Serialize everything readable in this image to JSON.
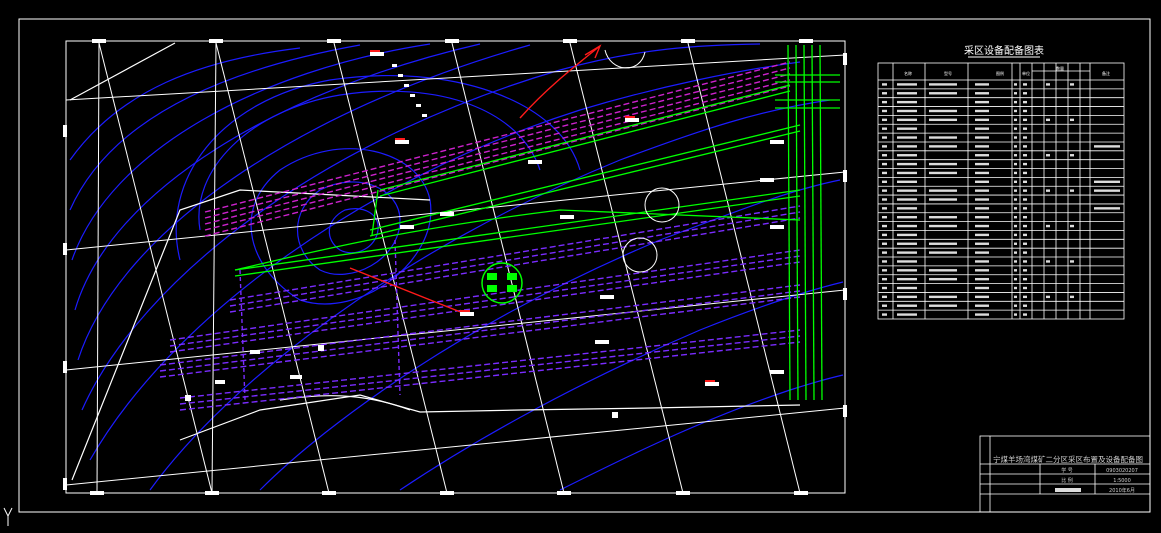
{
  "drawing": {
    "table_title": "采区设备配备图表",
    "title_block": {
      "main_title": "宁煤羊场湾煤矿二分区采区布置及设备配备图",
      "row1_label": "学  号",
      "row1_value": "0903020207",
      "row2_label": "比  例",
      "row2_value": "1:5000",
      "row3_value": "2010年6月"
    },
    "table_header": {
      "col_name": "名称",
      "col_model": "型号",
      "col_fig": "图例",
      "col_unit": "单位",
      "col_qty": "数量",
      "col_note": "备注"
    },
    "colors": {
      "background": "#000000",
      "frame": "#ffffff",
      "contour": "#1c1cff",
      "roadway": "#00ff00",
      "workface": "#cc22cc",
      "grid_line": "#ffffff",
      "annotation": "#ff1a1a"
    }
  }
}
